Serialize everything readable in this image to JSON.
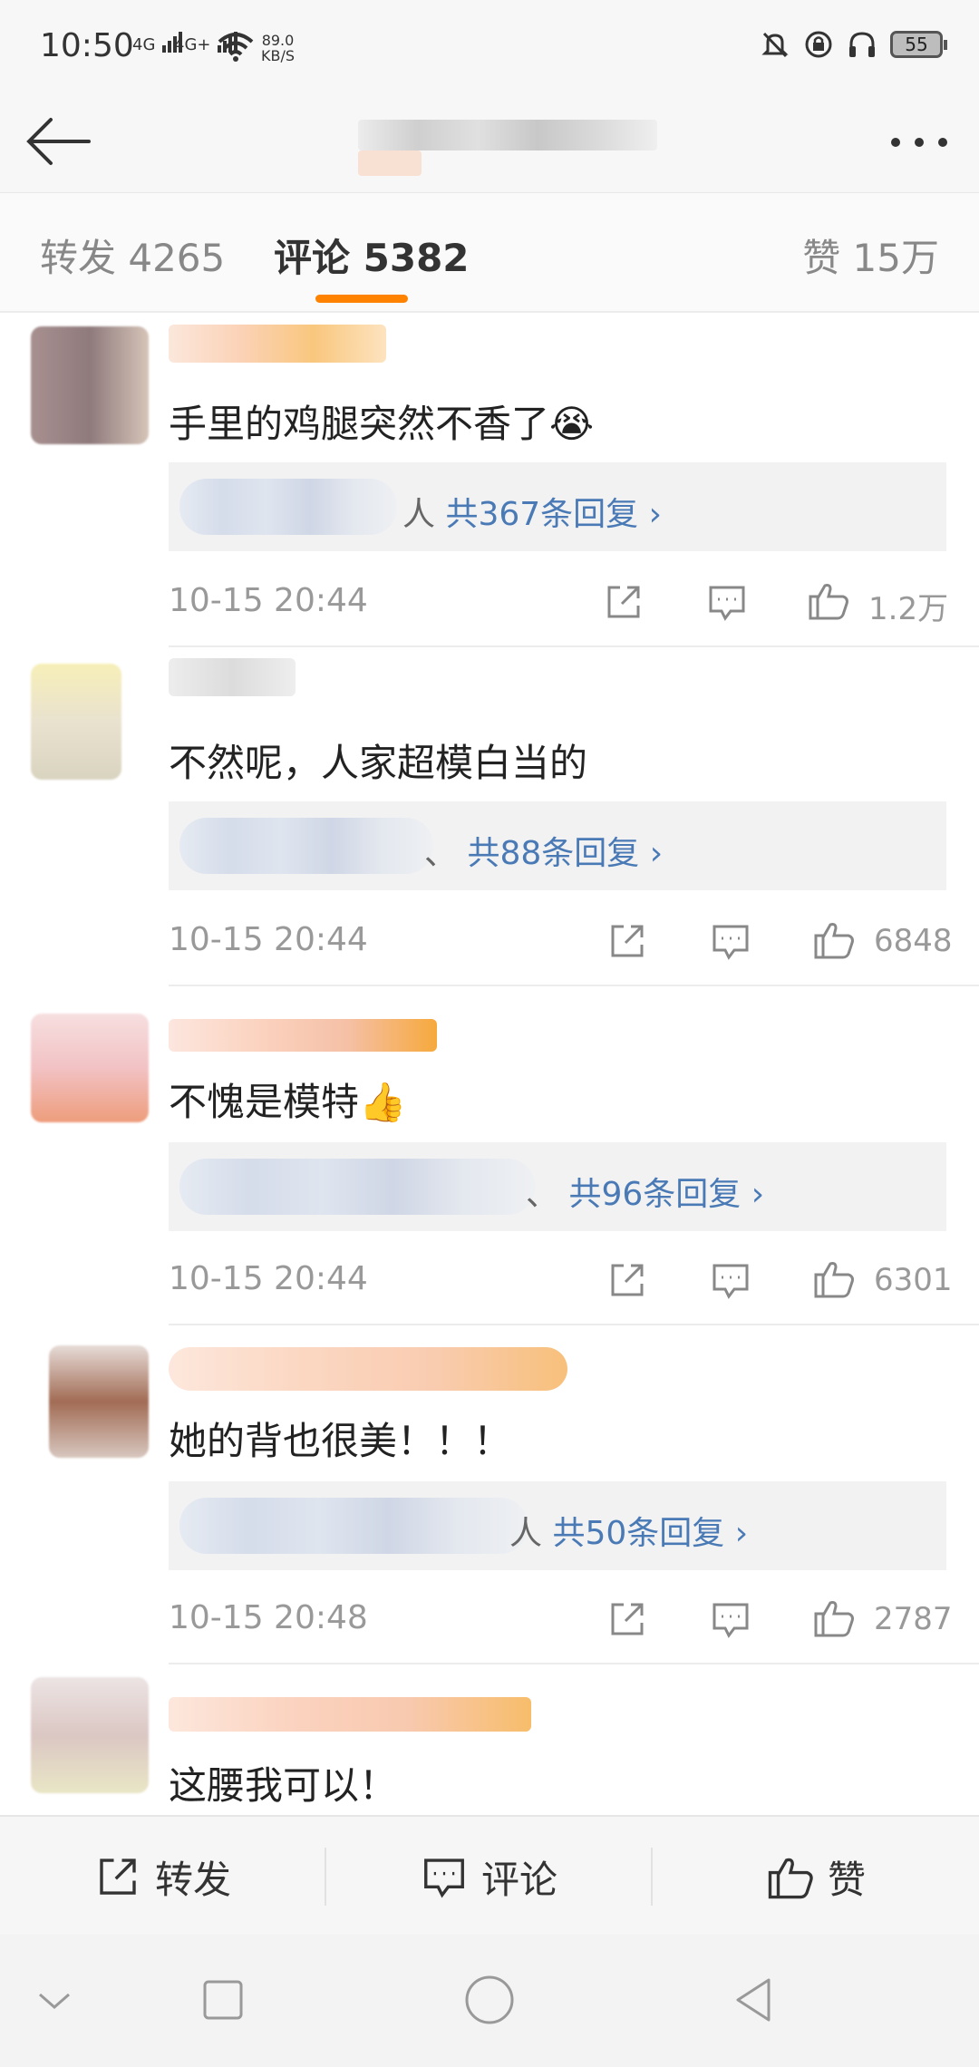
{
  "status_bar": {
    "time": "10:50",
    "signal1": "4G",
    "signal2": "4G+",
    "net_speed_value": "89.0",
    "net_speed_unit": "KB/S",
    "battery": "55"
  },
  "header": {
    "back_icon": "arrow-left-icon",
    "more_icon": "more-dots-icon"
  },
  "tabs": {
    "repost": "转发 4265",
    "comments": "评论 5382",
    "likes": "赞 15万"
  },
  "comments": [
    {
      "text": "手里的鸡腿突然不香了😭",
      "reply_sep": "人",
      "reply_count": "共367条回复 ›",
      "time": "10-15 20:44",
      "likes": "1.2万"
    },
    {
      "text": "不然呢，人家超模白当的",
      "reply_sep": "、",
      "reply_count": "共88条回复 ›",
      "time": "10-15 20:44",
      "likes": "6848"
    },
    {
      "text": "不愧是模特👍",
      "reply_sep": "、",
      "reply_count": "共96条回复 ›",
      "time": "10-15 20:44",
      "likes": "6301"
    },
    {
      "text": "她的背也很美！！！",
      "reply_sep": "人",
      "reply_count": "共50条回复 ›",
      "time": "10-15 20:48",
      "likes": "2787"
    },
    {
      "text": "这腰我可以！"
    }
  ],
  "bottom_bar": {
    "repost": "转发",
    "comment": "评论",
    "like": "赞"
  },
  "colors": {
    "accent": "#ff8200",
    "link": "#4a7ab6"
  }
}
